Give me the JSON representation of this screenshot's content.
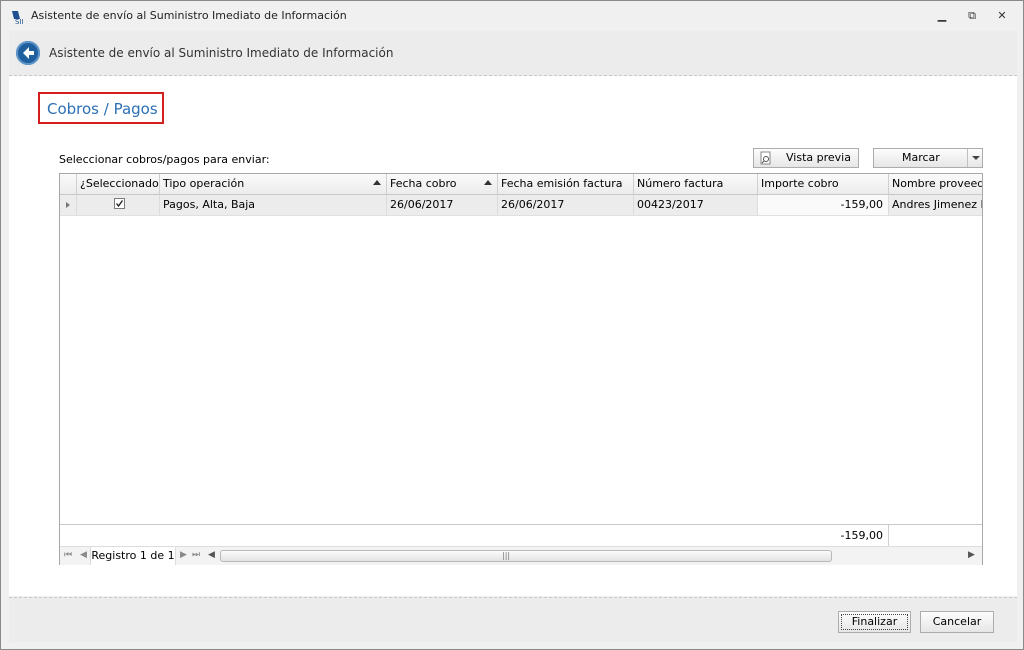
{
  "window": {
    "title": "Asistente de envío al Suministro Imediato de Información"
  },
  "header": {
    "title": "Asistente de envío al Suministro Imediato de Información"
  },
  "page": {
    "title": "Cobros / Pagos",
    "select_label": "Seleccionar cobros/pagos para enviar:"
  },
  "toolbar": {
    "preview_label": "Vista previa",
    "mark_label": "Marcar"
  },
  "grid": {
    "columns": [
      "¿Seleccionado?",
      "Tipo operación",
      "Fecha cobro",
      "Fecha emisión factura",
      "Número factura",
      "Importe cobro",
      "Nombre proveedor"
    ],
    "rows": [
      {
        "selected": true,
        "tipo": "Pagos, Alta, Baja",
        "fecha_cobro": "26/06/2017",
        "fecha_emision": "26/06/2017",
        "numero": "00423/2017",
        "importe": "-159,00",
        "proveedor": "Andres Jimenez Ra"
      }
    ],
    "total_importe": "-159,00",
    "record_text": "Registro 1 de 1"
  },
  "footer": {
    "finish_label": "Finalizar",
    "cancel_label": "Cancelar"
  },
  "icons": {
    "app": "sii-logo-icon",
    "back": "back-arrow-icon",
    "preview": "document-preview-icon"
  }
}
